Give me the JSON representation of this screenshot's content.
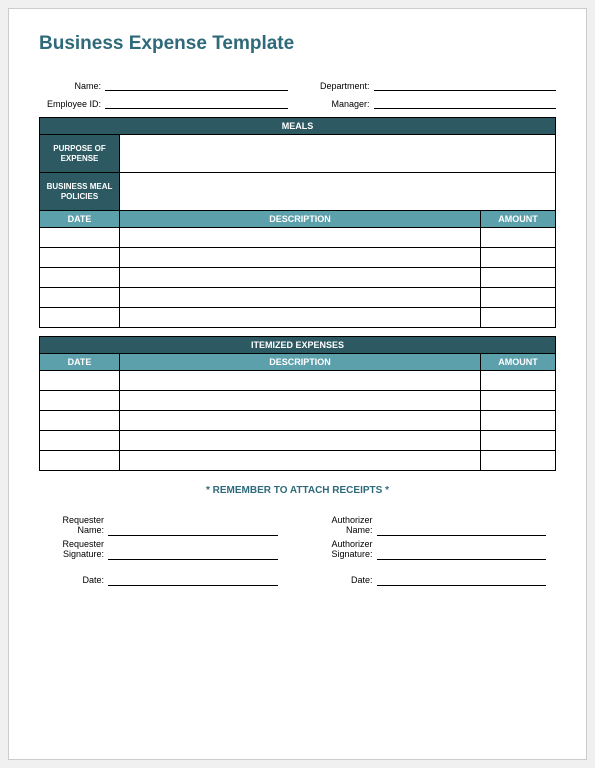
{
  "title": "Business Expense Template",
  "header": {
    "name_label": "Name:",
    "employee_id_label": "Employee ID:",
    "department_label": "Department:",
    "manager_label": "Manager:"
  },
  "meals": {
    "section_title": "MEALS",
    "purpose_label": "PURPOSE OF EXPENSE",
    "policies_label": "BUSINESS MEAL POLICIES",
    "col_date": "DATE",
    "col_description": "DESCRIPTION",
    "col_amount": "AMOUNT"
  },
  "itemized": {
    "section_title": "ITEMIZED EXPENSES",
    "col_date": "DATE",
    "col_description": "DESCRIPTION",
    "col_amount": "AMOUNT"
  },
  "reminder": "* REMEMBER TO ATTACH RECEIPTS *",
  "signatures": {
    "requester_name": "Requester\nName:",
    "requester_sig": "Requester\nSignature:",
    "authorizer_name": "Authorizer\nName:",
    "authorizer_sig": "Authorizer\nSignature:",
    "date_label": "Date:"
  }
}
